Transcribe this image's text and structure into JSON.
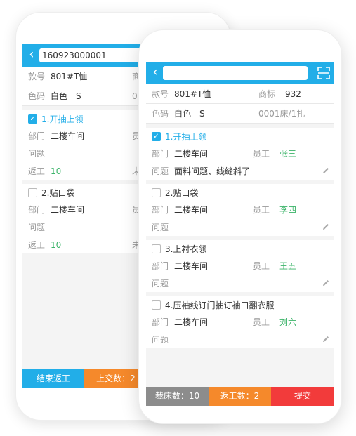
{
  "back_screen": {
    "search_value": "160923000001",
    "style_label": "款号",
    "style_value": "801#T恤",
    "trademark_label_partial": "商",
    "color_label": "色码",
    "color_value": "白色",
    "size_value": "S",
    "bed_partial": "00",
    "tasks": [
      {
        "title": "1.开抽上领",
        "checked": true,
        "dept_label": "部门",
        "dept_value": "二楼车间",
        "emp_label_partial": "员",
        "problem_label": "问题",
        "rework_label": "返工",
        "rework_value": "10",
        "unsubmitted_partial": "未"
      },
      {
        "title": "2.贴口袋",
        "checked": false,
        "dept_label": "部门",
        "dept_value": "二楼车间",
        "emp_label_partial": "员",
        "problem_label": "问题",
        "rework_label": "返工",
        "rework_value": "10",
        "unsubmitted_partial": "未"
      }
    ],
    "bottom": {
      "end_rework": "结束返工",
      "submitted": "上交数：2"
    }
  },
  "front_screen": {
    "search_value": "",
    "style_label": "款号",
    "style_value": "801#T恤",
    "trademark_label": "商标",
    "trademark_value": "932",
    "color_label": "色码",
    "color_value": "白色",
    "size_value": "S",
    "bed_text": "0001床/1扎",
    "tasks": [
      {
        "title": "1.开抽上领",
        "checked": true,
        "dept_label": "部门",
        "dept_value": "二楼车间",
        "emp_label": "员工",
        "emp_value": "张三",
        "problem_label": "问题",
        "problem_value": "面料问题、线缝斜了"
      },
      {
        "title": "2.贴口袋",
        "checked": false,
        "dept_label": "部门",
        "dept_value": "二楼车间",
        "emp_label": "员工",
        "emp_value": "李四",
        "problem_label": "问题",
        "problem_value": ""
      },
      {
        "title": "3.上衬衣领",
        "checked": false,
        "dept_label": "部门",
        "dept_value": "二楼车间",
        "emp_label": "员工",
        "emp_value": "王五",
        "problem_label": "问题",
        "problem_value": ""
      },
      {
        "title": "4.压袖线订门抽订袖口翻衣服",
        "checked": false,
        "dept_label": "部门",
        "dept_value": "二楼车间",
        "emp_label": "员工",
        "emp_value": "刘六",
        "problem_label": "问题",
        "problem_value": ""
      }
    ],
    "bottom": {
      "cut_count": "裁床数：10",
      "rework_count": "返工数：2",
      "submit": "提交"
    }
  },
  "colors": {
    "primary": "#22aee8",
    "orange": "#f5892b",
    "red": "#f23b3b",
    "gray": "#8c8c8c",
    "green": "#3cb46a"
  },
  "icons": {
    "back": "chevron-left-icon",
    "scan": "scan-icon",
    "edit": "pencil-icon",
    "check": "checkmark-icon"
  }
}
